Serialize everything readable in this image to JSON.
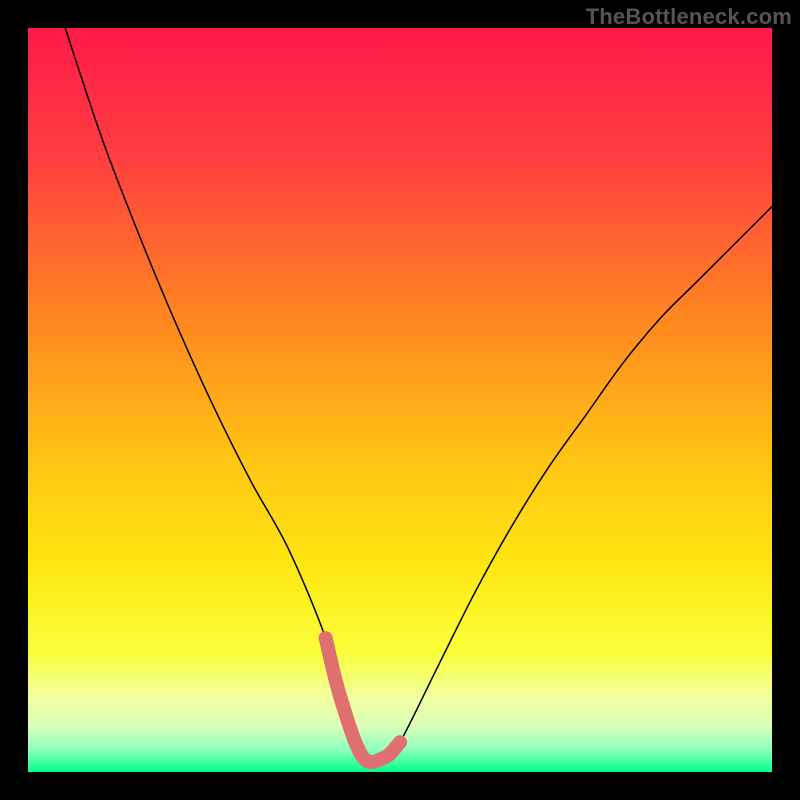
{
  "watermark": "TheBottleneck.com",
  "colors": {
    "curve_stroke": "#000000",
    "highlight_stroke": "#e07070",
    "gradient_top": "#ff1a49",
    "gradient_bottom": "#00ff88"
  },
  "chart_data": {
    "type": "line",
    "title": "",
    "xlabel": "",
    "ylabel": "",
    "xlim": [
      0,
      100
    ],
    "ylim": [
      0,
      100
    ],
    "x": [
      5,
      10,
      15,
      20,
      25,
      30,
      35,
      40,
      42,
      45,
      48,
      50,
      55,
      60,
      65,
      70,
      75,
      80,
      85,
      90,
      95,
      100
    ],
    "values": [
      100,
      85,
      72,
      60,
      49,
      39,
      30,
      18,
      10,
      2,
      2,
      4,
      14,
      24,
      33,
      41,
      48,
      55,
      61,
      66,
      71,
      76
    ],
    "highlight_x_range": [
      40,
      50
    ],
    "note": "V-shaped bottleneck curve; y=0 green (optimal), y=100 red (severe). Values read visually from gradient height; precision ~±3."
  }
}
